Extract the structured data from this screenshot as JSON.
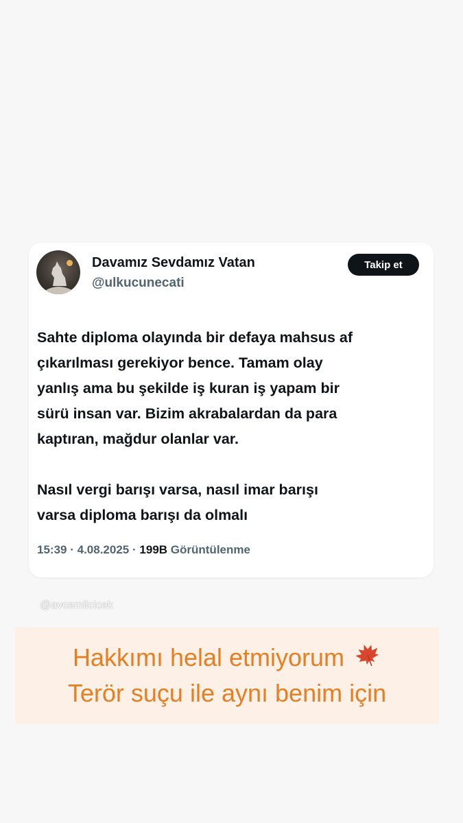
{
  "tweet": {
    "author_name": "Davamız Sevdamız Vatan",
    "author_handle": "@ulkucunecati",
    "follow_label": "Takip et",
    "paragraphs": [
      "Sahte diploma olayında bir defaya mahsus af\nçıkarılması gerekiyor bence. Tamam olay\nyanlış ama bu şekilde iş kuran iş yapam bir\nsürü insan var. Bizim akrabalardan da para\nkaptıran, mağdur olanlar var.",
      "Nasıl vergi barışı varsa, nasıl imar barışı\nvarsa diploma barışı da olmalı"
    ],
    "time": "15:39",
    "separator": "·",
    "date": "4.08.2025",
    "views_count": "199B",
    "views_label": "Görüntülenme"
  },
  "watermark": "@avcemilcicek",
  "caption": {
    "line1": "Hakkımı helal etmiyorum",
    "line2": "Terör suçu ile aynı benim için",
    "emoji_icon": "maple-leaf-icon"
  },
  "colors": {
    "page_background": "#f7f7f7",
    "caption_background": "#fdf0e6",
    "caption_text": "#e67e22",
    "follow_button": "#0f1419",
    "secondary_text": "#536471"
  }
}
